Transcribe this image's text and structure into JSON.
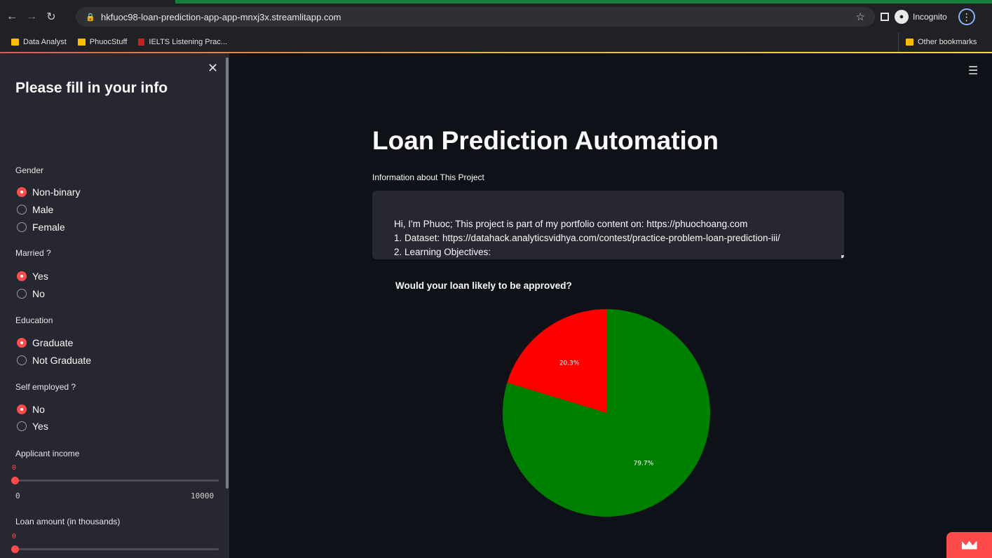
{
  "browser": {
    "url": "hkfuoc98-loan-prediction-app-app-mnxj3x.streamlitapp.com",
    "profile_label": "Incognito",
    "bookmarks": [
      {
        "label": "Data Analyst",
        "icon": "folder-icon"
      },
      {
        "label": "PhuocStuff",
        "icon": "folder-icon"
      },
      {
        "label": "IELTS Listening Prac...",
        "icon": "ielts-icon"
      }
    ],
    "other_bookmarks": "Other bookmarks"
  },
  "sidebar": {
    "title": "Please fill in your info",
    "gender": {
      "label": "Gender",
      "options": [
        "Non-binary",
        "Male",
        "Female"
      ],
      "selected": "Non-binary"
    },
    "married": {
      "label": "Married ?",
      "options": [
        "Yes",
        "No"
      ],
      "selected": "Yes"
    },
    "education": {
      "label": "Education",
      "options": [
        "Graduate",
        "Not Graduate"
      ],
      "selected": "Graduate"
    },
    "self_employed": {
      "label": "Self employed ?",
      "options": [
        "No",
        "Yes"
      ],
      "selected": "No"
    },
    "applicant_income": {
      "label": "Applicant income",
      "value": "0",
      "min": "0",
      "max": "10000"
    },
    "loan_amount": {
      "label": "Loan amount (in thousands)",
      "value": "0"
    }
  },
  "main": {
    "title": "Loan Prediction Automation",
    "info_label": "Information about This Project",
    "info_lines": [
      "Hi, I'm Phuoc; This project is part of my portfolio content on: https://phuochoang.com",
      "1. Dataset: https://datahack.analyticsvidhya.com/contest/practice-problem-loan-prediction-iii/",
      "2. Learning Objectives:"
    ]
  },
  "colors": {
    "accent": "#ff4b4b",
    "approved": "#008000",
    "rejected": "#ff0000"
  },
  "chart_data": {
    "type": "pie",
    "title": "Would your loan likely to be approved?",
    "slices": [
      {
        "label": "20.3%",
        "value": 20.3,
        "color": "#ff0000"
      },
      {
        "label": "79.7%",
        "value": 79.7,
        "color": "#008000"
      }
    ],
    "start_angle": "top",
    "direction": "counterclockwise"
  }
}
